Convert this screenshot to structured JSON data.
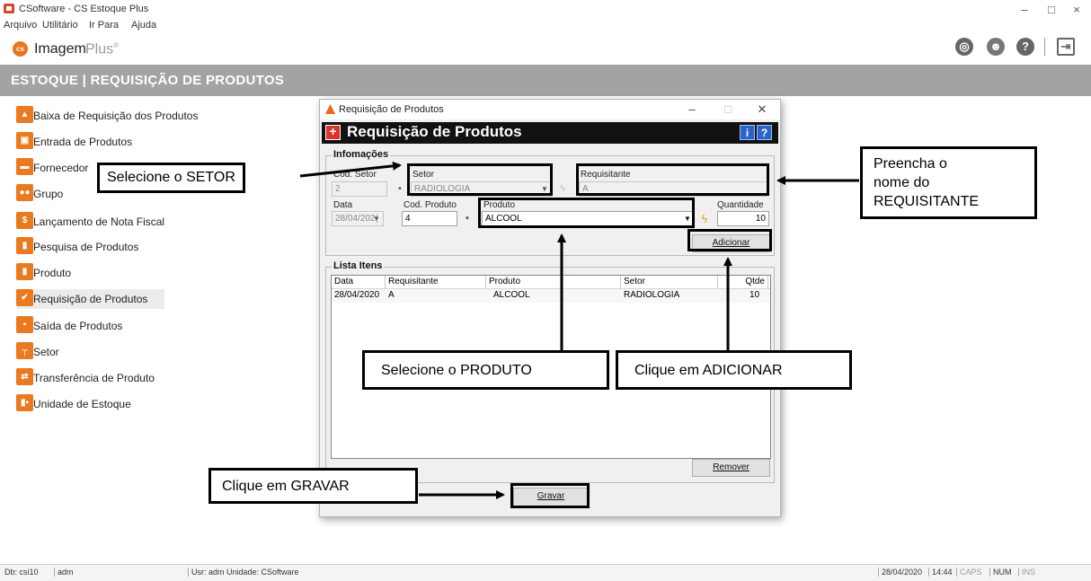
{
  "window": {
    "title": "CSoftware - CS Estoque Plus",
    "controls": [
      "–",
      "□",
      "×"
    ]
  },
  "menubar": [
    "Arquivo",
    "Utilitário",
    "Ir Para",
    "Ajuda"
  ],
  "brand": {
    "logo_text": "cs",
    "name1": "Imagem",
    "name2": "Plus",
    "mark": "®"
  },
  "top_icons": [
    "globe-icon",
    "user-icon",
    "help-icon",
    "exit-icon"
  ],
  "section_title": "ESTOQUE | REQUISIÇÃO DE PRODUTOS",
  "sidebar": {
    "items": [
      {
        "label": "Baixa de Requisição dos Produtos",
        "icon": "box-up-icon"
      },
      {
        "label": "Entrada de Produtos",
        "icon": "box-open-icon"
      },
      {
        "label": "Fornecedor",
        "icon": "truck-icon"
      },
      {
        "label": "Grupo",
        "icon": "group-icon"
      },
      {
        "label": "Lançamento de Nota Fiscal",
        "icon": "dollar-icon"
      },
      {
        "label": "Pesquisa de Produtos",
        "icon": "cylinder-icon"
      },
      {
        "label": "Produto",
        "icon": "cylinder-icon"
      },
      {
        "label": "Requisição de Produtos",
        "icon": "check-icon"
      },
      {
        "label": "Saída de Produtos",
        "icon": "box-out-icon"
      },
      {
        "label": "Setor",
        "icon": "org-chart-icon"
      },
      {
        "label": "Transferência de Produto",
        "icon": "transfer-icon"
      },
      {
        "label": "Unidade de Estoque",
        "icon": "cylinder-box-icon"
      }
    ],
    "active_index": 7
  },
  "dialog": {
    "title": "Requisição de Produtos",
    "header": "Requisição de Produtos",
    "group_info": "Infomações",
    "labels": {
      "cod_setor": "Cod. Setor",
      "setor": "Setor",
      "requisitante": "Requisitante",
      "data": "Data",
      "cod_produto": "Cod. Produto",
      "produto": "Produto",
      "quantidade": "Quantidade"
    },
    "values": {
      "cod_setor": "2",
      "setor": "RADIOLOGIA",
      "requisitante": "A",
      "data": "28/04/202(",
      "cod_produto": "4",
      "produto": "ALCOOL",
      "quantidade": "10"
    },
    "buttons": {
      "adicionar": "Adicionar",
      "remover": "Remover",
      "gravar": "Gravar"
    },
    "group_list": "Lista Itens",
    "list": {
      "columns": [
        "Data",
        "Requisitante",
        "Produto",
        "Setor",
        "Qtde"
      ],
      "rows": [
        {
          "data": "28/04/2020",
          "requisitante": "A",
          "produto": "ALCOOL",
          "setor": "RADIOLOGIA",
          "qtde": "10"
        }
      ]
    }
  },
  "callouts": {
    "setor": "Selecione o SETOR",
    "requisitante_l1": "Preencha o",
    "requisitante_l2": "nome do",
    "requisitante_l3": "REQUISITANTE",
    "produto": "Selecione o PRODUTO",
    "adicionar": "Clique em ADICIONAR",
    "gravar": "Clique em GRAVAR"
  },
  "statusbar": {
    "db": "Db: csi10",
    "user": "adm",
    "usr_unit": "Usr: adm  Unidade: CSoftware",
    "date": "28/04/2020",
    "time": "14:44",
    "caps": "CAPS",
    "num": "NUM",
    "ins": "INS"
  }
}
